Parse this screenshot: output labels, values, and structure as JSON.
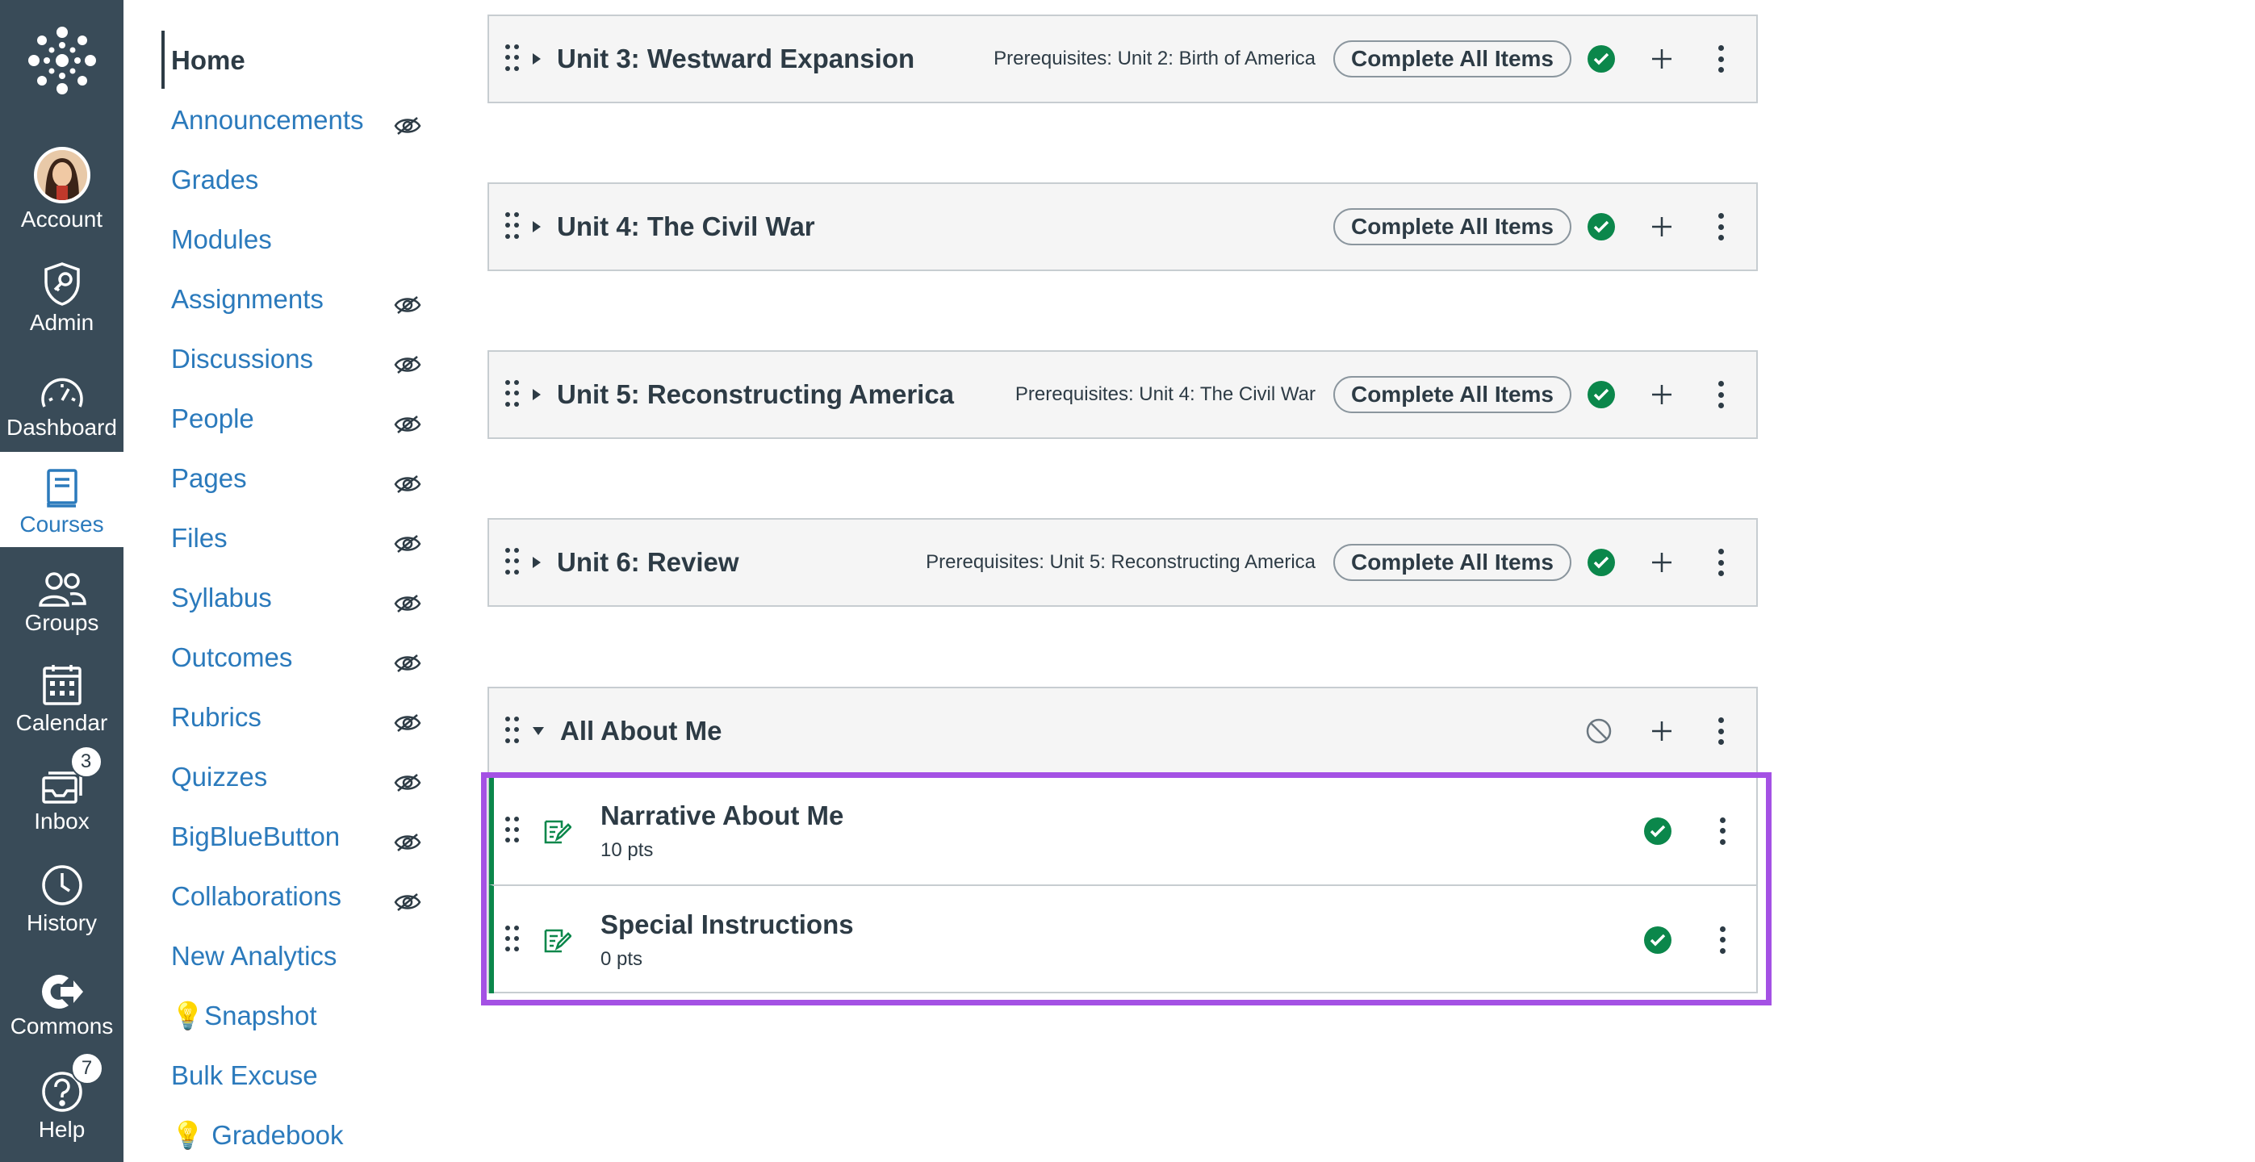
{
  "global_nav": {
    "items": [
      {
        "label": "Account",
        "icon": "avatar"
      },
      {
        "label": "Admin",
        "icon": "shield-key-icon"
      },
      {
        "label": "Dashboard",
        "icon": "speedometer-icon"
      },
      {
        "label": "Courses",
        "icon": "book-icon"
      },
      {
        "label": "Groups",
        "icon": "people-icon"
      },
      {
        "label": "Calendar",
        "icon": "calendar-icon"
      },
      {
        "label": "Inbox",
        "icon": "inbox-icon",
        "badge": "3"
      },
      {
        "label": "History",
        "icon": "clock-icon"
      },
      {
        "label": "Commons",
        "icon": "commons-icon"
      },
      {
        "label": "Help",
        "icon": "help-icon",
        "badge": "7"
      }
    ],
    "active": "Courses",
    "background": "#394b58"
  },
  "course_nav": {
    "items": [
      {
        "label": "Home",
        "hidden": false
      },
      {
        "label": "Announcements",
        "hidden": true
      },
      {
        "label": "Grades",
        "hidden": false
      },
      {
        "label": "Modules",
        "hidden": false
      },
      {
        "label": "Assignments",
        "hidden": true
      },
      {
        "label": "Discussions",
        "hidden": true
      },
      {
        "label": "People",
        "hidden": true
      },
      {
        "label": "Pages",
        "hidden": true
      },
      {
        "label": "Files",
        "hidden": true
      },
      {
        "label": "Syllabus",
        "hidden": true
      },
      {
        "label": "Outcomes",
        "hidden": true
      },
      {
        "label": "Rubrics",
        "hidden": true
      },
      {
        "label": "Quizzes",
        "hidden": true
      },
      {
        "label": "BigBlueButton",
        "hidden": true
      },
      {
        "label": "Collaborations",
        "hidden": true
      },
      {
        "label": "New Analytics",
        "hidden": false
      },
      {
        "label": "💡Snapshot",
        "hidden": false
      },
      {
        "label": "Bulk Excuse",
        "hidden": false
      },
      {
        "label": "💡 Gradebook",
        "hidden": false
      }
    ]
  },
  "modules": [
    {
      "title": "Unit 3: Westward Expansion",
      "prerequisites": "Prerequisites: Unit 2: Birth of America",
      "requirement": "Complete All Items"
    },
    {
      "title": "Unit 4: The Civil War",
      "prerequisites": "",
      "requirement": "Complete All Items"
    },
    {
      "title": "Unit 5: Reconstructing America",
      "prerequisites": "Prerequisites: Unit 4: The Civil War",
      "requirement": "Complete All Items"
    },
    {
      "title": "Unit 6: Review",
      "prerequisites": "Prerequisites: Unit 5: Reconstructing America",
      "requirement": "Complete All Items"
    },
    {
      "title": "All About Me",
      "prerequisites": "",
      "requirement": ""
    }
  ],
  "module_items": [
    {
      "title": "Narrative About Me",
      "points": "10 pts"
    },
    {
      "title": "Special Instructions",
      "points": "0 pts"
    }
  ],
  "colors": {
    "link": "#2b7abc",
    "published": "#0b874b",
    "highlight": "#a451e4",
    "module_header": "#f5f5f5"
  }
}
